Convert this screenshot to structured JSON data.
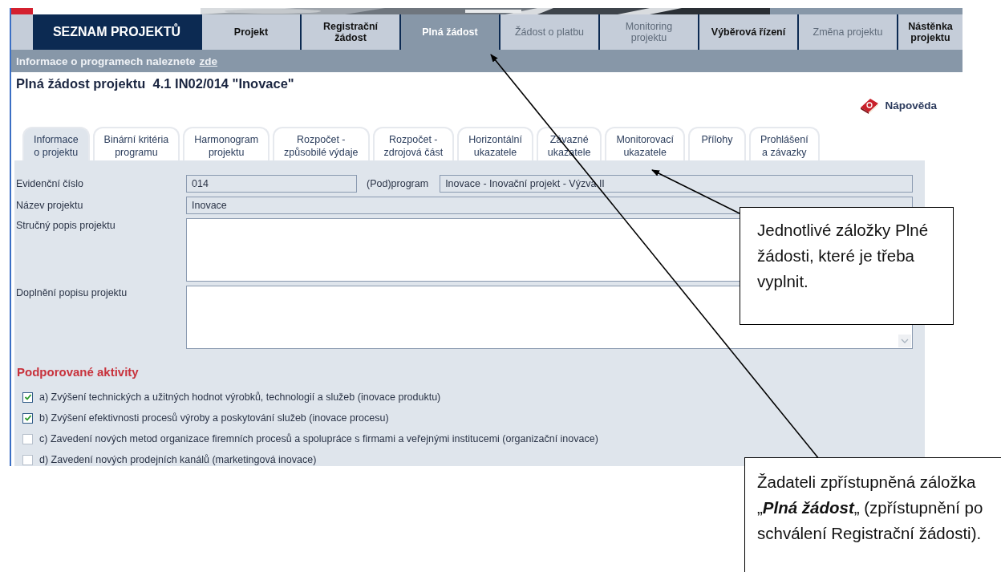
{
  "header": {
    "home": "SEZNAM PROJEKTŮ",
    "nav_tabs": [
      {
        "label": "Projekt",
        "selected": false,
        "disabled": false
      },
      {
        "label": "Registrační\nžádost",
        "selected": false,
        "disabled": false
      },
      {
        "label": "Plná žádost",
        "selected": true,
        "disabled": false
      },
      {
        "label": "Žádost o platbu",
        "selected": false,
        "disabled": true
      },
      {
        "label": "Monitoring\nprojektu",
        "selected": false,
        "disabled": true
      },
      {
        "label": "Výběrová řízení",
        "selected": false,
        "disabled": false
      },
      {
        "label": "Změna projektu",
        "selected": false,
        "disabled": true
      },
      {
        "label": "Nástěnka\nprojektu",
        "selected": false,
        "disabled": false
      }
    ]
  },
  "info_bar": {
    "text": "Informace o programech naleznete",
    "link": "zde"
  },
  "title": "Plná žádost projektu  4.1 IN02/014 \"Inovace\"",
  "help_link": "Nápověda",
  "form_tabs": [
    {
      "label": "Informace\no projektu",
      "selected": true
    },
    {
      "label": "Binární kritéria\nprogramu",
      "selected": false
    },
    {
      "label": "Harmonogram\nprojektu",
      "selected": false
    },
    {
      "label": "Rozpočet -\nzpůsobilé výdaje",
      "selected": false
    },
    {
      "label": "Rozpočet -\nzdrojová část",
      "selected": false
    },
    {
      "label": "Horizontální\nukazatele",
      "selected": false
    },
    {
      "label": "Závazné\nukazatele",
      "selected": false
    },
    {
      "label": "Monitorovací\nukazatele",
      "selected": false
    },
    {
      "label": "Přílohy",
      "selected": false
    },
    {
      "label": "Prohlášení\na závazky",
      "selected": false
    }
  ],
  "fields": [
    {
      "kind": "short",
      "label": "Evidenční číslo",
      "value": "014"
    },
    {
      "kind": "inline",
      "label": "(Pod)program",
      "value": "Inovace - Inovační projekt - Výzva II"
    },
    {
      "kind": "line",
      "label": "Název projektu",
      "value": "Inovace"
    },
    {
      "kind": "area",
      "label": "Stručný popis projektu"
    },
    {
      "kind": "area",
      "label": "Doplnění popisu projektu"
    }
  ],
  "activities": {
    "heading": "Podporované aktivity",
    "items": [
      {
        "label": "a) Zvýšení technických a užitných hodnot výrobků, technologií a služeb (inovace produktu)",
        "checked": true
      },
      {
        "label": "b) Zvýšení efektivnosti procesů výroby a poskytování služeb (inovace procesu)",
        "checked": true
      },
      {
        "label": "c) Zavedení nových metod organizace firemních procesů a spolupráce s firmami a veřejnými institucemi (organizační inovace)",
        "checked": false
      },
      {
        "label": "d) Zavedení nových prodejních kanálů (marketingová inovace)",
        "checked": false
      }
    ]
  },
  "callouts": [
    {
      "text": "Jednotlivé záložky Plné žádosti, které je třeba vyplnit."
    },
    {
      "text": "Žadateli zpřístupněná záložka „**Plná žádost**„ (zpřístupnění po schválení Registrační žádosti)."
    }
  ]
}
